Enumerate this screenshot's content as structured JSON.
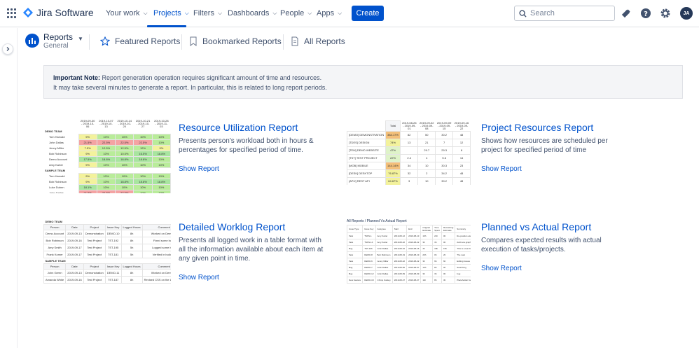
{
  "topbar": {
    "app_name": "Jira Software",
    "nav": [
      {
        "label": "Your work"
      },
      {
        "label": "Projects"
      },
      {
        "label": "Filters"
      },
      {
        "label": "Dashboards"
      },
      {
        "label": "People"
      },
      {
        "label": "Apps"
      }
    ],
    "create_label": "Create",
    "search_placeholder": "Search",
    "avatar_initials": "JA"
  },
  "project": {
    "name": "Reports",
    "type": "General"
  },
  "subnav": {
    "featured": "Featured Reports",
    "bookmarked": "Bookmarked Reports",
    "all": "All Reports"
  },
  "note": {
    "heading": "Important Note:",
    "line1": " Report generation operation requires significant amount of time and resources.",
    "line2": "It may take several minutes to generate a report. In particular, this is related to long report periods."
  },
  "reports": [
    {
      "title": "Resource Utilization Report",
      "description": "Presents person's workload both in hours & percentages for specified period of time.",
      "link": "Show Report"
    },
    {
      "title": "Project Resources Report",
      "description": "Shows how resources are scheduled per project for specified period of time",
      "link": "Show Report"
    },
    {
      "title": "Detailed Worklog Report",
      "description": "Presents all logged work in a table format with all the information available about each item at any given point in time.",
      "link": "Show Report"
    },
    {
      "title": "Planned vs Actual Report",
      "description": "Compares expected results with actual execution of tasks/projects.",
      "link": "Show Report"
    }
  ],
  "thumb_utilization": {
    "headers": [
      "2019-09-30 - 2019-10-06",
      "2019-10-07 - 2019-10-13",
      "2019-10-14 - 2019-10-20",
      "2019-10-21 - 2019-10-27",
      "2019-10-28 - 2019-11-03"
    ],
    "groups": [
      {
        "name": "DEMO TEAM",
        "rows": [
          {
            "name": "Tom Harvald",
            "cells": [
              "9%",
              "10%",
              "10%",
              "10%",
              "10%"
            ]
          },
          {
            "name": "John Dallas",
            "cells": [
              "21.5%",
              "22.5%",
              "22.5%",
              "22.5%",
              "10%"
            ]
          },
          {
            "name": "Jenny Miller",
            "cells": [
              "7.5%",
              "12.5%",
              "12.5%",
              "12%",
              "9%"
            ]
          },
          {
            "name": "Bob Robinson",
            "cells": [
              "9%",
              "10%",
              "10.5%",
              "16.5%",
              "18.8%"
            ]
          },
          {
            "name": "Demo Account",
            "cells": [
              "17.5%",
              "18.8%",
              "18.8%",
              "18.8%",
              "10%"
            ]
          },
          {
            "name": "Amy Kartel",
            "cells": [
              "9%",
              "10%",
              "10%",
              "10%",
              "10%"
            ]
          }
        ]
      },
      {
        "name": "SAMPLE TEAM",
        "rows": [
          {
            "name": "Tom Harvald",
            "cells": [
              "9%",
              "10%",
              "10%",
              "10%",
              "10%"
            ]
          },
          {
            "name": "Bob Robinson",
            "cells": [
              "9%",
              "10%",
              "18.8%",
              "18.8%",
              "18.8%"
            ]
          },
          {
            "name": "Luke Duben",
            "cells": [
              "18.1%",
              "10%",
              "10%",
              "10%",
              "10%"
            ]
          },
          {
            "name": "John Dallas",
            "cells": [
              "21.5%",
              "22.5%",
              "22.5%",
              "10%",
              "10%"
            ]
          },
          {
            "name": "Frank Komer",
            "cells": [
              "4%",
              "10%",
              "10%",
              "10%",
              "10%"
            ]
          }
        ]
      }
    ]
  },
  "thumb_project": {
    "headers": [
      "Total",
      "2019-08-26 - 2019-09-01",
      "2019-09-02 - 2019-09-08",
      "2019-09-09 - 2019-09-15",
      "2019-09-16 - 2019-09-22"
    ],
    "rows": [
      {
        "name": "[DEMO] DEMONSTRATION",
        "cells": [
          "384.17%",
          "82",
          "50",
          "30.2",
          "48"
        ]
      },
      {
        "name": "[TDES] DESIGN",
        "cells": [
          "74%",
          "13",
          "21",
          "7",
          "12"
        ]
      },
      {
        "name": "[TEM] DEMO WEBSITE",
        "cells": [
          "47%",
          "",
          "29.7",
          "29.3",
          "8"
        ]
      },
      {
        "name": "[TST] TEST PROJECT",
        "cells": [
          "22%",
          "2.4",
          "4",
          "5.6",
          "14"
        ]
      },
      {
        "name": "[MOB] MOBILE",
        "cells": [
          "144.14%",
          "34",
          "10",
          "30.3",
          "23"
        ]
      },
      {
        "name": "[DESK] DESKTOP",
        "cells": [
          "76.87%",
          "32",
          "2",
          "34.2",
          "48"
        ]
      },
      {
        "name": "[APIJ] REST API",
        "cells": [
          "64.67%",
          "3",
          "10",
          "30.2",
          "48"
        ]
      }
    ]
  },
  "thumb_worklog": {
    "team1": "DEMO TEAM",
    "team2": "SAMPLE TEAM",
    "headers": [
      "Person",
      "Date",
      "Project",
      "Issue Key",
      "Logged Hours",
      "Comment"
    ],
    "rows1": [
      [
        "Demo Account",
        "2019-09-13",
        "Demonstration",
        "DEMO-10",
        "8h",
        "Worked on Demo-10"
      ],
      [
        "Bob Robinson",
        "2019-09-16",
        "Test Project",
        "TST-192",
        "8h",
        "Fixed some bugs"
      ],
      [
        "Amy Smith",
        "2019-09-17",
        "Test Project",
        "TST-195",
        "5h",
        "Logged some bugs"
      ],
      [
        "Frank Komer",
        "2019-09-17",
        "Test Project",
        "TST-181",
        "5h",
        "Verified in build 35"
      ]
    ],
    "rows2": [
      [
        "John Green",
        "2019-09-13",
        "Demonstration",
        "DEMO-11",
        "8h",
        "Worked on Demo-11"
      ],
      [
        "Amanda White",
        "2019-09-16",
        "Test Project",
        "TST-187",
        "8h",
        "Revised CSS on the Login page"
      ]
    ]
  },
  "thumb_planned": {
    "caption": "All Reports / Planned Vs Actual Report",
    "headers": [
      "Issue Type",
      "Issue Key",
      "Assignee",
      "Start",
      "End",
      "Original Estimate",
      "Time Spent",
      "Remaining Estimate",
      "Summary",
      "Deviation, h",
      "Deviation, %",
      "Status"
    ],
    "rows": [
      {
        "cells": [
          "Task",
          "TSKS-1",
          "Amy Kartel",
          "2019-08-12",
          "2019-08-13",
          "16h",
          "21h",
          "0h",
          "Re-position elements",
          "-5h",
          "-131.25%",
          "UNDERESTIMATED"
        ],
        "tone": "red"
      },
      {
        "cells": [
          "Task",
          "TSKS-14",
          "Amy Kartel",
          "2019-08-22",
          "2019-08-22",
          "3h",
          "3h",
          "0h",
          "Add new graphics",
          "0h",
          "0%",
          "OK"
        ],
        "tone": "green"
      },
      {
        "cells": [
          "Bug",
          "TST-106",
          "John Dallas",
          "2019-08-16",
          "2019-08-16",
          "4h",
          "18h",
          "15h",
          "This is a test bug",
          "-14h",
          "-750%",
          "UNDERESTIMATED"
        ],
        "tone": "red"
      },
      {
        "cells": [
          "Task",
          "DEMO-8",
          "Bob Robinson",
          "2019-08-19",
          "2019-08-19",
          "20h",
          "0h",
          "2h",
          "The Last",
          "2h",
          "100%",
          "OK"
        ],
        "tone": "green"
      },
      {
        "cells": [
          "Task",
          "DEMO-6",
          "Jenny Miller",
          "2019-08-22",
          "2019-08-22",
          "3h",
          "9h",
          "6h",
          "Editing Issues",
          "-6h",
          "-300%",
          "UNDERESTIMATED"
        ],
        "tone": "red"
      },
      {
        "cells": [
          "Bug",
          "DEMO-7",
          "John Dallas",
          "2019-08-05",
          "2019-08-07",
          "10h",
          "8h",
          "0h",
          "Searching",
          "2h",
          "20%",
          "OVERESTIMATED"
        ],
        "tone": "yellow"
      },
      {
        "cells": [
          "Bug",
          "DEMO-12",
          "John Dallas",
          "2019-08-09",
          "2019-08-09",
          "3h",
          "3h",
          "0h",
          "bug",
          "0h",
          "100%",
          "OK"
        ],
        "tone": "green"
      },
      {
        "cells": [
          "New Feature",
          "DEMO-18",
          "Chimp Zuckey",
          "2019-08-27",
          "2019-08-27",
          "11h",
          "8h",
          "3h",
          "Placeholder for Demo-10",
          "0h",
          "0%",
          "OK"
        ],
        "tone": "green"
      }
    ]
  },
  "colors": {
    "brand": "#0052cc",
    "red_cell": "#f4a3a3",
    "green_cell": "#a8e59f",
    "yellow_cell": "#f7f29a"
  }
}
